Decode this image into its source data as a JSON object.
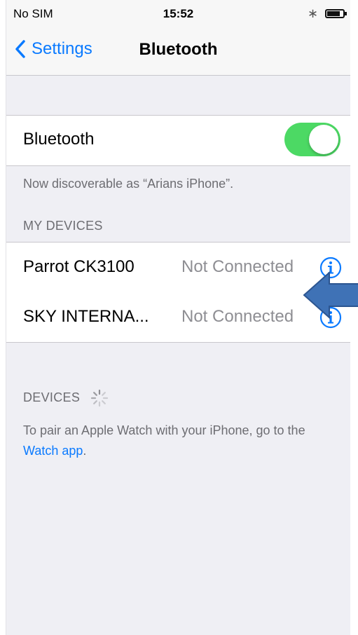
{
  "status_bar": {
    "carrier": "No SIM",
    "time": "15:52",
    "battery_level": 0.75
  },
  "nav": {
    "back_label": "Settings",
    "title": "Bluetooth"
  },
  "bluetooth": {
    "label": "Bluetooth",
    "enabled": true,
    "toggle_color": "#4cd964"
  },
  "discoverable_text": "Now discoverable as “Arians iPhone”.",
  "my_devices": {
    "header": "MY DEVICES",
    "items": [
      {
        "name": "Parrot CK3100",
        "status": "Not Connected"
      },
      {
        "name": "SKY INTERNA...",
        "status": "Not Connected"
      }
    ]
  },
  "devices": {
    "header": "DEVICES"
  },
  "pair_watch": {
    "text_before": "To pair an Apple Watch with your iPhone, go to the ",
    "link": "Watch app",
    "text_after": "."
  },
  "colors": {
    "accent": "#0a7aff",
    "annotation_arrow": "#3f72b6"
  }
}
